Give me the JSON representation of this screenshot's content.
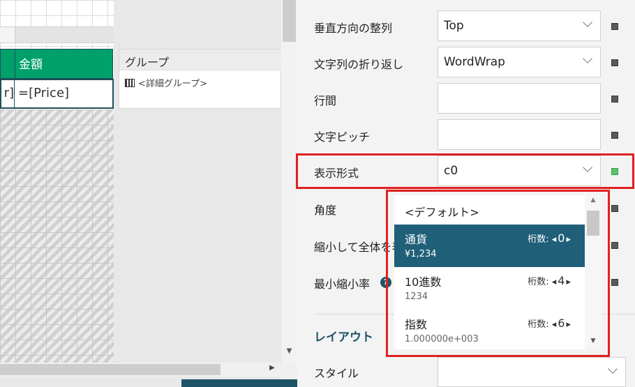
{
  "designer": {
    "header_amount": "金額",
    "cell_left": "r]",
    "cell_price": "=[Price]",
    "group_title": "グループ",
    "group_row": "<詳細グループ>"
  },
  "properties": {
    "rows": [
      {
        "label": "垂直方向の整列",
        "value": "Top",
        "type": "select"
      },
      {
        "label": "文字列の折り返し",
        "value": "WordWrap",
        "type": "select"
      },
      {
        "label": "行間",
        "value": "",
        "type": "text"
      },
      {
        "label": "文字ピッチ",
        "value": "",
        "type": "text"
      },
      {
        "label": "表示形式",
        "value": "c0",
        "type": "select"
      },
      {
        "label": "角度",
        "value": "",
        "type": "text"
      },
      {
        "label": "縮小して全体を表示",
        "value": "",
        "type": "text"
      },
      {
        "label": "最小縮小率",
        "value": "",
        "type": "text"
      }
    ],
    "help_icon": "?",
    "section_layout": "レイアウト",
    "style_label": "スタイル",
    "style_value": ""
  },
  "format_dropdown": {
    "default_label": "<デフォルト>",
    "digits_label": "桁数:",
    "items": [
      {
        "name": "通貨",
        "example": "¥1,234",
        "digits": "0",
        "selected": true
      },
      {
        "name": "10進数",
        "example": "1234",
        "digits": "4",
        "selected": false
      },
      {
        "name": "指数",
        "example": "1.000000e+003",
        "digits": "6",
        "selected": false
      }
    ]
  },
  "colors": {
    "header_green": "#00a06a",
    "selected_blue": "#1f5f78",
    "highlight_red": "#e02020",
    "accent_dark": "#1f5468"
  }
}
